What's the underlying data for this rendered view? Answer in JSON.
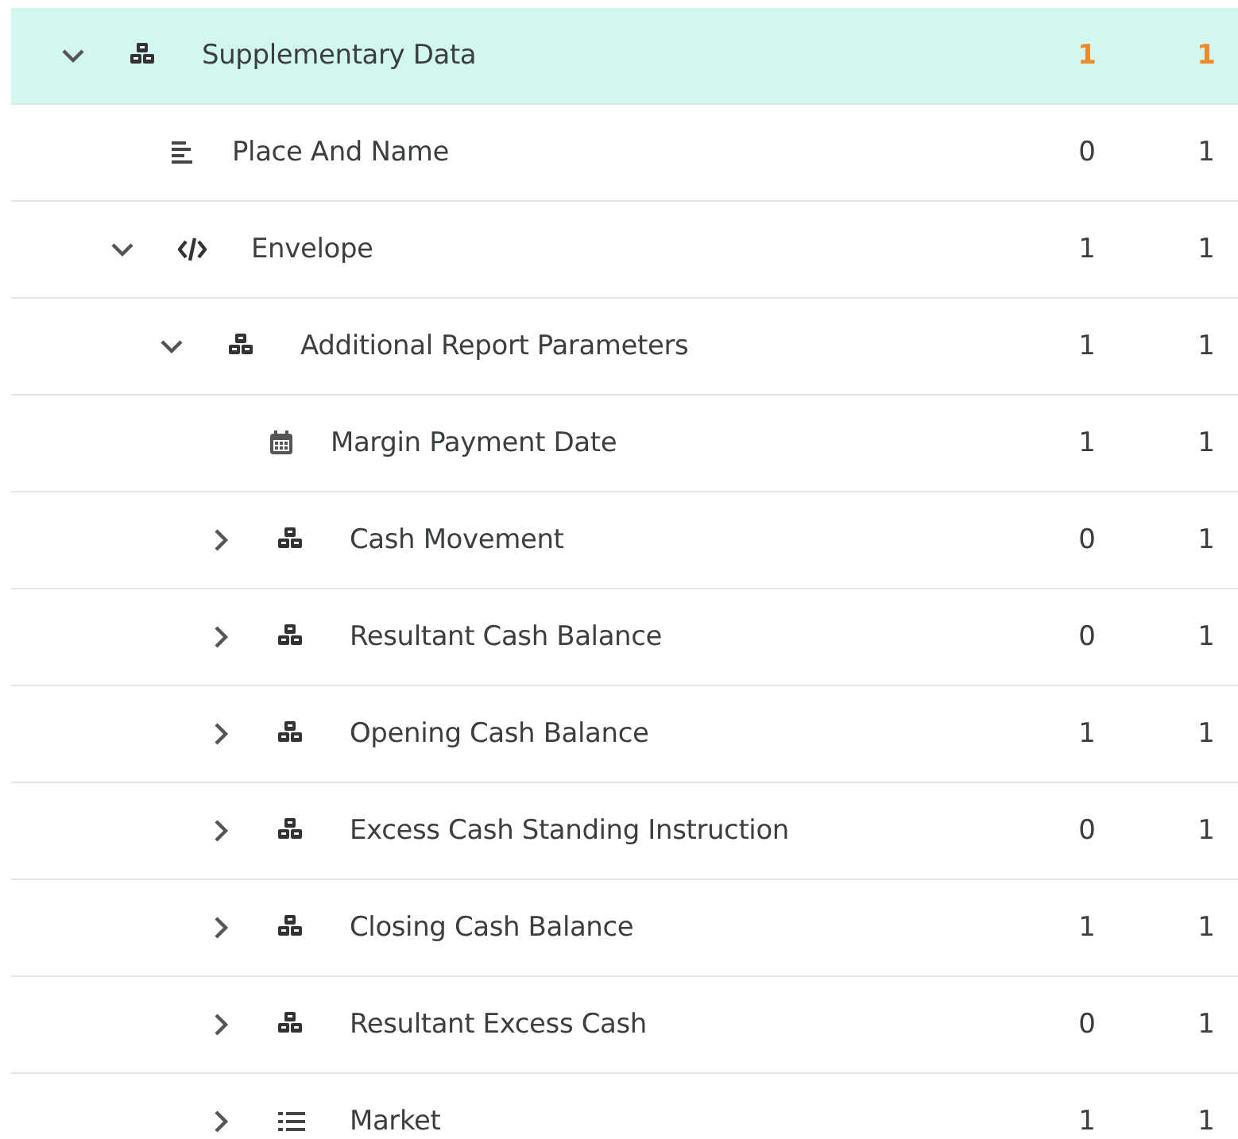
{
  "tree": [
    {
      "label": "Supplementary Data",
      "kind": "group",
      "expanded": true,
      "selected": true,
      "column_1": "1",
      "column_2": "1",
      "children": [
        {
          "label": "Place And Name",
          "kind": "text",
          "selected": false,
          "column_1": "0",
          "column_2": "1"
        },
        {
          "label": "Envelope",
          "kind": "code",
          "expanded": true,
          "selected": false,
          "column_1": "1",
          "column_2": "1",
          "children": [
            {
              "label": "Additional Report Parameters",
              "kind": "group",
              "expanded": true,
              "selected": false,
              "column_1": "1",
              "column_2": "1",
              "children": [
                {
                  "label": "Margin Payment Date",
                  "kind": "date",
                  "selected": false,
                  "column_1": "1",
                  "column_2": "1"
                },
                {
                  "label": "Cash Movement",
                  "kind": "group",
                  "expanded": false,
                  "selected": false,
                  "column_1": "0",
                  "column_2": "1"
                },
                {
                  "label": "Resultant Cash Balance",
                  "kind": "group",
                  "expanded": false,
                  "selected": false,
                  "column_1": "0",
                  "column_2": "1"
                },
                {
                  "label": "Opening Cash Balance",
                  "kind": "group",
                  "expanded": false,
                  "selected": false,
                  "column_1": "1",
                  "column_2": "1"
                },
                {
                  "label": "Excess Cash Standing Instruction",
                  "kind": "group",
                  "expanded": false,
                  "selected": false,
                  "column_1": "0",
                  "column_2": "1"
                },
                {
                  "label": "Closing Cash Balance",
                  "kind": "group",
                  "expanded": false,
                  "selected": false,
                  "column_1": "1",
                  "column_2": "1"
                },
                {
                  "label": "Resultant Excess Cash",
                  "kind": "group",
                  "expanded": false,
                  "selected": false,
                  "column_1": "0",
                  "column_2": "1"
                },
                {
                  "label": "Market",
                  "kind": "list",
                  "expanded": false,
                  "selected": false,
                  "column_1": "1",
                  "column_2": "1"
                }
              ]
            }
          ]
        }
      ]
    }
  ]
}
